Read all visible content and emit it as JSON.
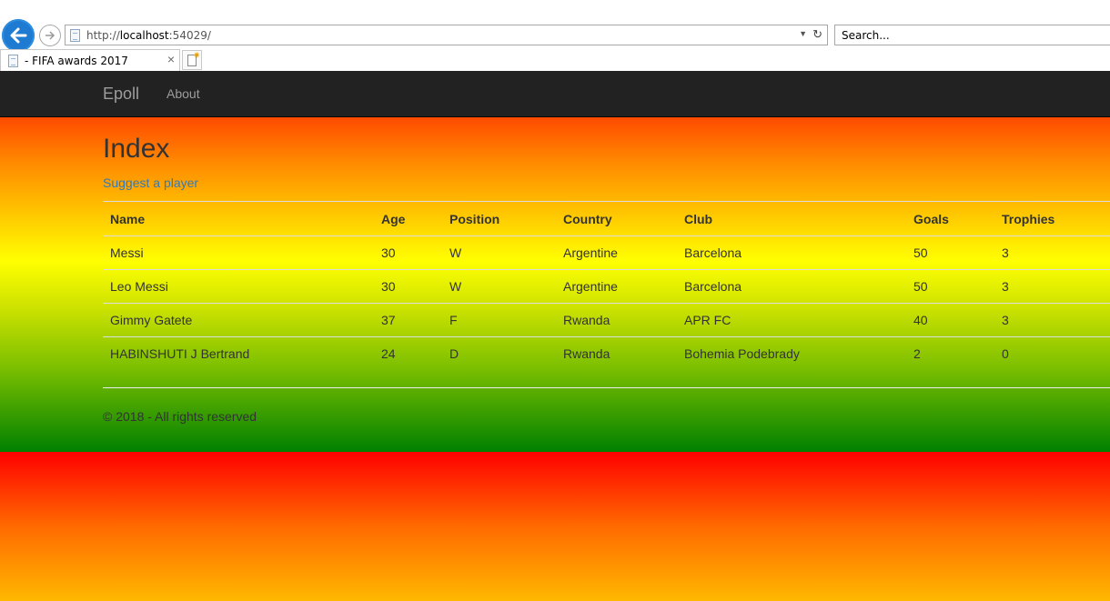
{
  "browser": {
    "url_scheme": "http://",
    "url_host": "localhost",
    "url_rest": ":54029/",
    "search_placeholder": "Search...",
    "tab_title": "- FIFA awards 2017",
    "tab_close": "×"
  },
  "navbar": {
    "brand": "Epoll",
    "links": [
      "About"
    ]
  },
  "main": {
    "heading": "Index",
    "suggest_link": "Suggest a player",
    "table": {
      "headers": [
        "Name",
        "Age",
        "Position",
        "Country",
        "Club",
        "Goals",
        "Trophies"
      ],
      "rows": [
        [
          "Messi",
          "30",
          "W",
          "Argentine",
          "Barcelona",
          "50",
          "3"
        ],
        [
          "Leo Messi",
          "30",
          "W",
          "Argentine",
          "Barcelona",
          "50",
          "3"
        ],
        [
          "Gimmy Gatete",
          "37",
          "F",
          "Rwanda",
          "APR FC",
          "40",
          "3"
        ],
        [
          "HABINSHUTI J Bertrand",
          "24",
          "D",
          "Rwanda",
          "Bohemia Podebrady",
          "2",
          "0"
        ]
      ]
    }
  },
  "footer": {
    "text": "© 2018 - All rights reserved"
  },
  "colors": {
    "navbar_bg": "#222222",
    "link": "#337ab7",
    "back_button": "#1f7bd1"
  }
}
